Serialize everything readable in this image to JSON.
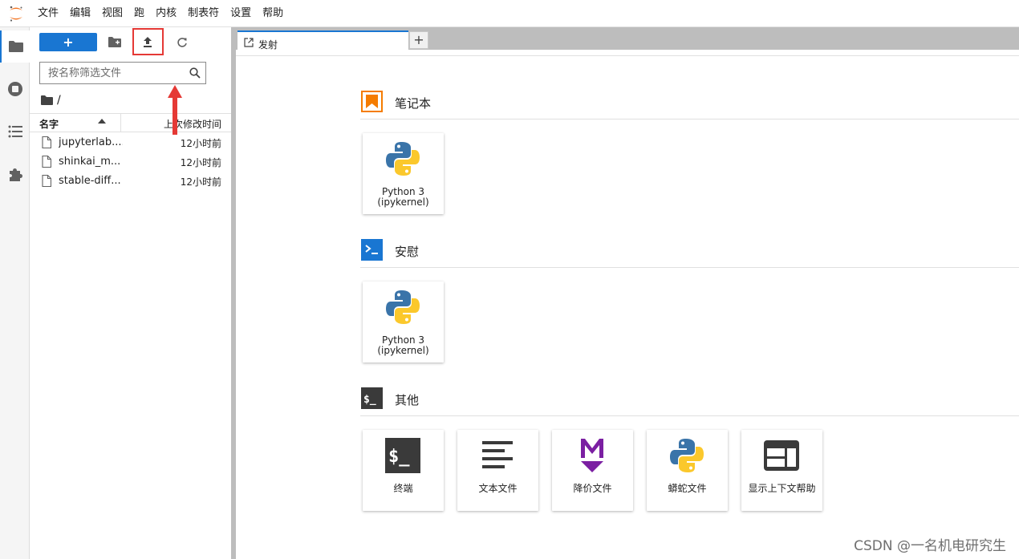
{
  "menubar": {
    "items": [
      "文件",
      "编辑",
      "视图",
      "跑",
      "内核",
      "制表符",
      "设置",
      "帮助"
    ]
  },
  "sidebar_tabs": [
    {
      "icon": "folder-icon",
      "active": true
    },
    {
      "icon": "stop-circle-icon",
      "active": false
    },
    {
      "icon": "list-icon",
      "active": false
    },
    {
      "icon": "puzzle-piece-icon",
      "active": false
    }
  ],
  "filebrowser": {
    "new_label": "+",
    "search_placeholder": "按名称筛选文件",
    "breadcrumb": "/",
    "col_name": "名字",
    "col_modified": "上次修改时间",
    "files": [
      {
        "name": "jupyterlab....",
        "modified": "12小时前"
      },
      {
        "name": "shinkai_m...",
        "modified": "12小时前"
      },
      {
        "name": "stable-diff...",
        "modified": "12小时前"
      }
    ]
  },
  "tabs": [
    {
      "label": "发射"
    }
  ],
  "tab_add_label": "+",
  "launcher": {
    "sections": [
      {
        "title": "笔记本",
        "cards": [
          {
            "line1": "Python 3",
            "line2": "(ipykernel)"
          }
        ]
      },
      {
        "title": "安慰",
        "cards": [
          {
            "line1": "Python 3",
            "line2": "(ipykernel)"
          }
        ]
      },
      {
        "title": "其他",
        "cards": [
          {
            "label": "终端"
          },
          {
            "label": "文本文件"
          },
          {
            "label": "降价文件"
          },
          {
            "label": "蟒蛇文件"
          },
          {
            "label": "显示上下文帮助"
          }
        ]
      }
    ]
  },
  "watermark": "CSDN @一名机电研究生",
  "colors": {
    "accent": "#1976d2",
    "highlight": "#e53935",
    "notebook": "#f57c00",
    "console": "#1976d2",
    "other": "#3a3a3a",
    "markdown": "#7b1fa2"
  }
}
